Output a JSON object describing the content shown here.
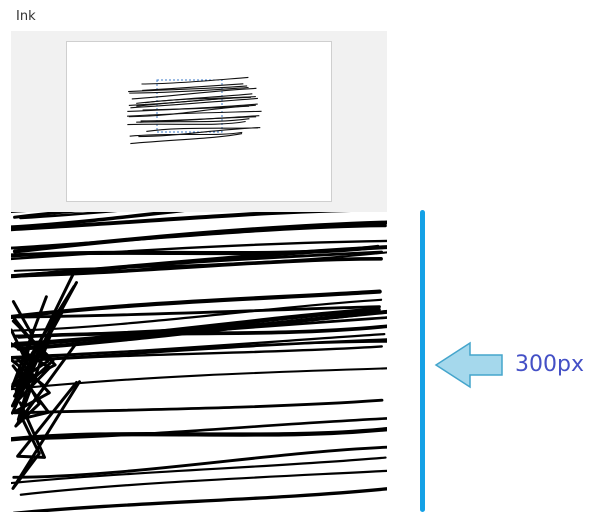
{
  "panel": {
    "title": "Ink"
  },
  "annotation": {
    "label": "300px",
    "line_color": "#14a1e6",
    "arrow_fill": "#a5d8ec",
    "arrow_stroke": "#45a5cc",
    "label_color": "#4450c6"
  },
  "icons": {
    "arrow": "left-arrow-icon"
  }
}
